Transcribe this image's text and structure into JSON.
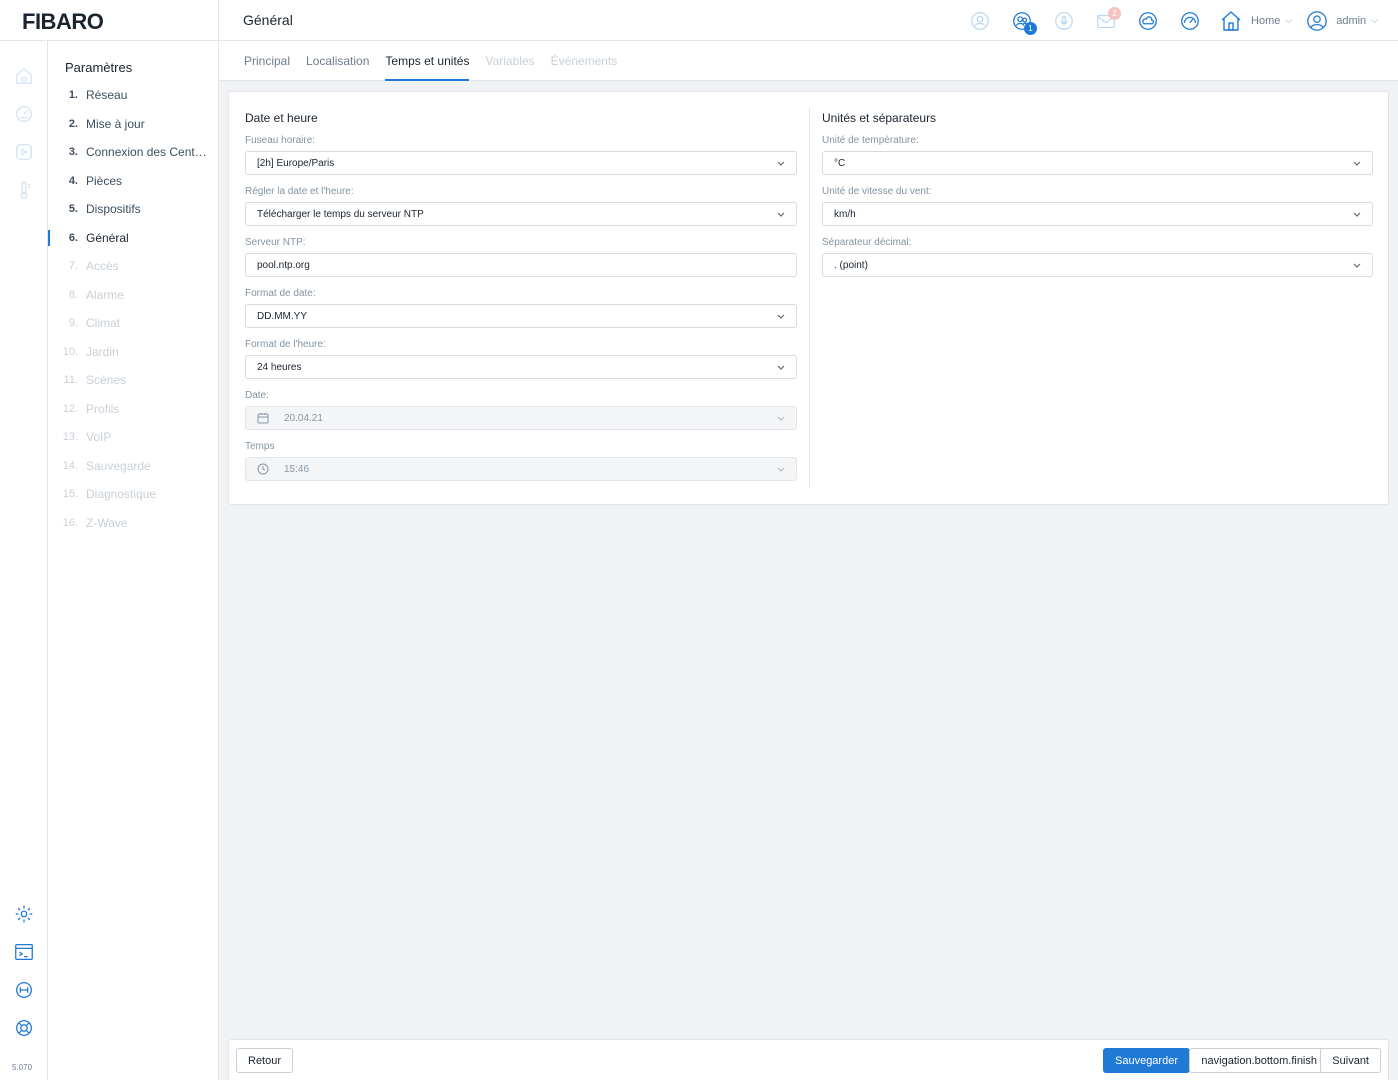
{
  "app": {
    "logo": "FIBARO",
    "page_title": "Général",
    "version": "5.070"
  },
  "header": {
    "icons": [
      {
        "name": "lock-user-icon",
        "badge": ""
      },
      {
        "name": "users-icon",
        "badge": "1"
      },
      {
        "name": "microphone-icon",
        "badge": ""
      },
      {
        "name": "mail-icon",
        "badge": "2"
      },
      {
        "name": "weather-icon",
        "badge": ""
      },
      {
        "name": "energy-gauge-icon",
        "badge": ""
      }
    ],
    "home_label": "Home",
    "user_label": "admin"
  },
  "rail": {
    "top_icons": [
      "home-icon",
      "dashboard-icon",
      "scenes-icon",
      "climate-icon"
    ],
    "bottom_icons": [
      "settings-icon",
      "terminal-icon",
      "api-icon",
      "help-icon"
    ]
  },
  "nav": {
    "title": "Paramètres",
    "items": [
      {
        "num": "1.",
        "label": "Réseau",
        "state": "normal"
      },
      {
        "num": "2.",
        "label": "Mise à jour",
        "state": "normal"
      },
      {
        "num": "3.",
        "label": "Connexion des Centrales",
        "state": "normal"
      },
      {
        "num": "4.",
        "label": "Pièces",
        "state": "normal"
      },
      {
        "num": "5.",
        "label": "Dispositifs",
        "state": "normal"
      },
      {
        "num": "6.",
        "label": "Général",
        "state": "active"
      },
      {
        "num": "7.",
        "label": "Accès",
        "state": "disabled"
      },
      {
        "num": "8.",
        "label": "Alarme",
        "state": "disabled"
      },
      {
        "num": "9.",
        "label": "Climat",
        "state": "disabled"
      },
      {
        "num": "10.",
        "label": "Jardin",
        "state": "disabled"
      },
      {
        "num": "11.",
        "label": "Scènes",
        "state": "disabled"
      },
      {
        "num": "12.",
        "label": "Profils",
        "state": "disabled"
      },
      {
        "num": "13.",
        "label": "VoIP",
        "state": "disabled"
      },
      {
        "num": "14.",
        "label": "Sauvegarde",
        "state": "disabled"
      },
      {
        "num": "15.",
        "label": "Diagnostique",
        "state": "disabled"
      },
      {
        "num": "16.",
        "label": "Z-Wave",
        "state": "disabled"
      }
    ]
  },
  "tabs": [
    {
      "label": "Principal",
      "state": "normal"
    },
    {
      "label": "Localisation",
      "state": "normal"
    },
    {
      "label": "Temps et unités",
      "state": "active"
    },
    {
      "label": "Variables",
      "state": "disabled"
    },
    {
      "label": "Événements",
      "state": "disabled"
    }
  ],
  "date_time": {
    "title": "Date et heure",
    "timezone": {
      "label": "Fuseau horaire:",
      "value": "[2h] Europe/Paris"
    },
    "set_datetime": {
      "label": "Régler la date et l'heure:",
      "value": "Télécharger le temps du serveur NTP"
    },
    "ntp_server": {
      "label": "Serveur NTP:",
      "value": "pool.ntp.org"
    },
    "date_format": {
      "label": "Format de date:",
      "value": "DD.MM.YY"
    },
    "time_format": {
      "label": "Format de l'heure:",
      "value": "24 heures"
    },
    "date": {
      "label": "Date:",
      "value": "20.04.21"
    },
    "time": {
      "label": "Temps",
      "value": "15:46"
    }
  },
  "units": {
    "title": "Unités et séparateurs",
    "temperature": {
      "label": "Unité de température:",
      "value": "°C"
    },
    "wind_speed": {
      "label": "Unité de vitesse du vent:",
      "value": "km/h"
    },
    "decimal_separator": {
      "label": "Séparateur décimal:",
      "value": ". (point)"
    }
  },
  "footer": {
    "back_label": "Retour",
    "save_label": "Sauvegarder",
    "finish_label": "navigation.bottom.finish",
    "next_label": "Suivant"
  },
  "colors": {
    "accent": "#1f7ad6",
    "badge_faded": "#f5c2c2"
  }
}
